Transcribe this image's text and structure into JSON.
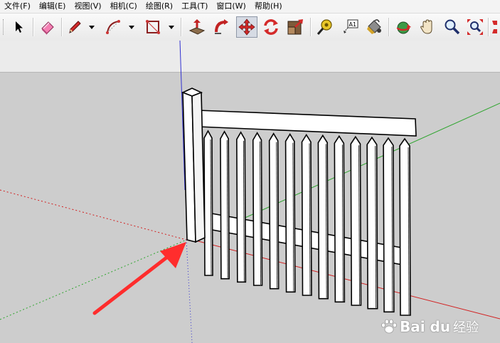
{
  "menubar": {
    "items": [
      "文件(F)",
      "编辑(E)",
      "视图(V)",
      "相机(C)",
      "绘图(R)",
      "工具(T)",
      "窗口(W)",
      "帮助(H)"
    ]
  },
  "toolbar": {
    "tools": [
      {
        "name": "select-tool-icon"
      },
      {
        "name": "eraser-tool-icon"
      },
      {
        "name": "pencil-tool-icon"
      },
      {
        "name": "arc-tool-icon"
      },
      {
        "name": "shape-tool-icon"
      },
      {
        "name": "push-pull-tool-icon"
      },
      {
        "name": "follow-me-tool-icon"
      },
      {
        "name": "move-tool-icon",
        "active": true
      },
      {
        "name": "rotate-tool-icon"
      },
      {
        "name": "scale-tool-icon"
      },
      {
        "name": "tape-measure-tool-icon"
      },
      {
        "name": "text-tool-icon"
      },
      {
        "name": "paint-bucket-tool-icon"
      },
      {
        "name": "orbit-tool-icon"
      },
      {
        "name": "pan-tool-icon"
      },
      {
        "name": "zoom-tool-icon"
      },
      {
        "name": "zoom-extents-tool-icon"
      }
    ],
    "text_tool_label": "A1"
  },
  "colors": {
    "sky": "#ebebeb",
    "ground": "#cdcdcd",
    "axis_red": "#d22020",
    "axis_green": "#2fa52f",
    "axis_blue": "#3030d0",
    "annotation_arrow": "#ff2d2d",
    "fence_fill": "#ffffff",
    "fence_edge": "#000000"
  },
  "viewport": {
    "model": "picket-fence"
  },
  "watermark": {
    "brand": "Bai du",
    "sub": "经验"
  }
}
